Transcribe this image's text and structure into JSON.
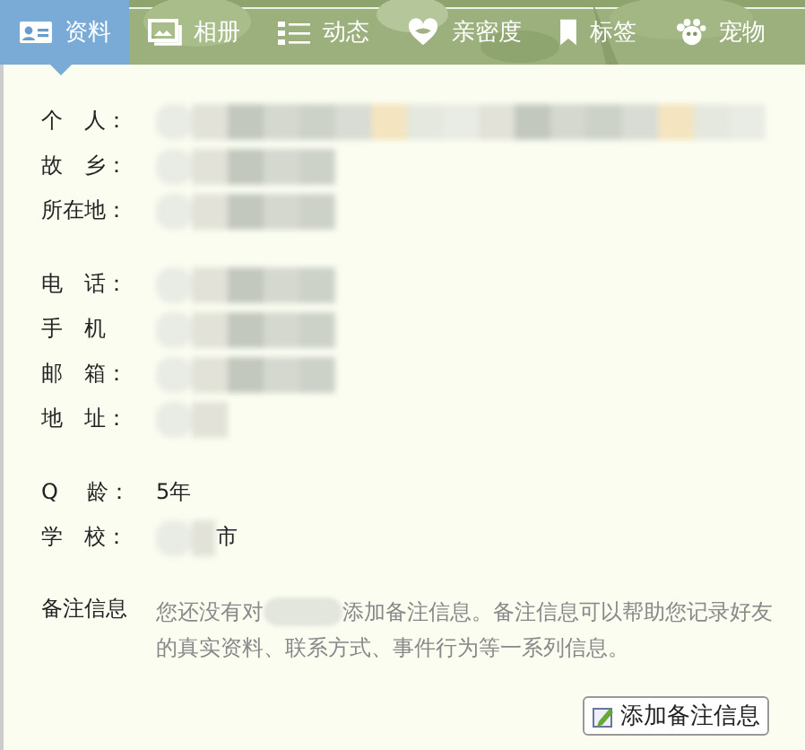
{
  "tabs": [
    {
      "label": "资料",
      "selected": true
    },
    {
      "label": "相册",
      "selected": false
    },
    {
      "label": "动态",
      "selected": false
    },
    {
      "label": "亲密度",
      "selected": false
    },
    {
      "label": "标签",
      "selected": false
    },
    {
      "label": "宠物",
      "selected": false
    }
  ],
  "groups": [
    [
      {
        "label": "个　人：",
        "kind": "blurred"
      },
      {
        "label": "故　乡：",
        "kind": "blurred"
      },
      {
        "label": "所在地：",
        "kind": "blurred"
      }
    ],
    [
      {
        "label": "电　话：",
        "kind": "blurred"
      },
      {
        "label": "手　机",
        "kind": "blurred"
      },
      {
        "label": "邮　箱：",
        "kind": "blurred"
      },
      {
        "label": "地　址：",
        "kind": "blurred"
      }
    ],
    [
      {
        "label": "Q　 龄：",
        "kind": "plain",
        "value": "5年"
      },
      {
        "label": "学　校：",
        "kind": "blurred",
        "value": "市"
      }
    ]
  ],
  "note": {
    "label": "备注信息",
    "text_before": "您还没有对",
    "text_after": "添加备注信息。备注信息可以帮助您记录好友",
    "text_line_2": "的真实资料、联系方式、事件行为等一系列信息。"
  },
  "add_note_button": {
    "label": "添加备注信息"
  }
}
